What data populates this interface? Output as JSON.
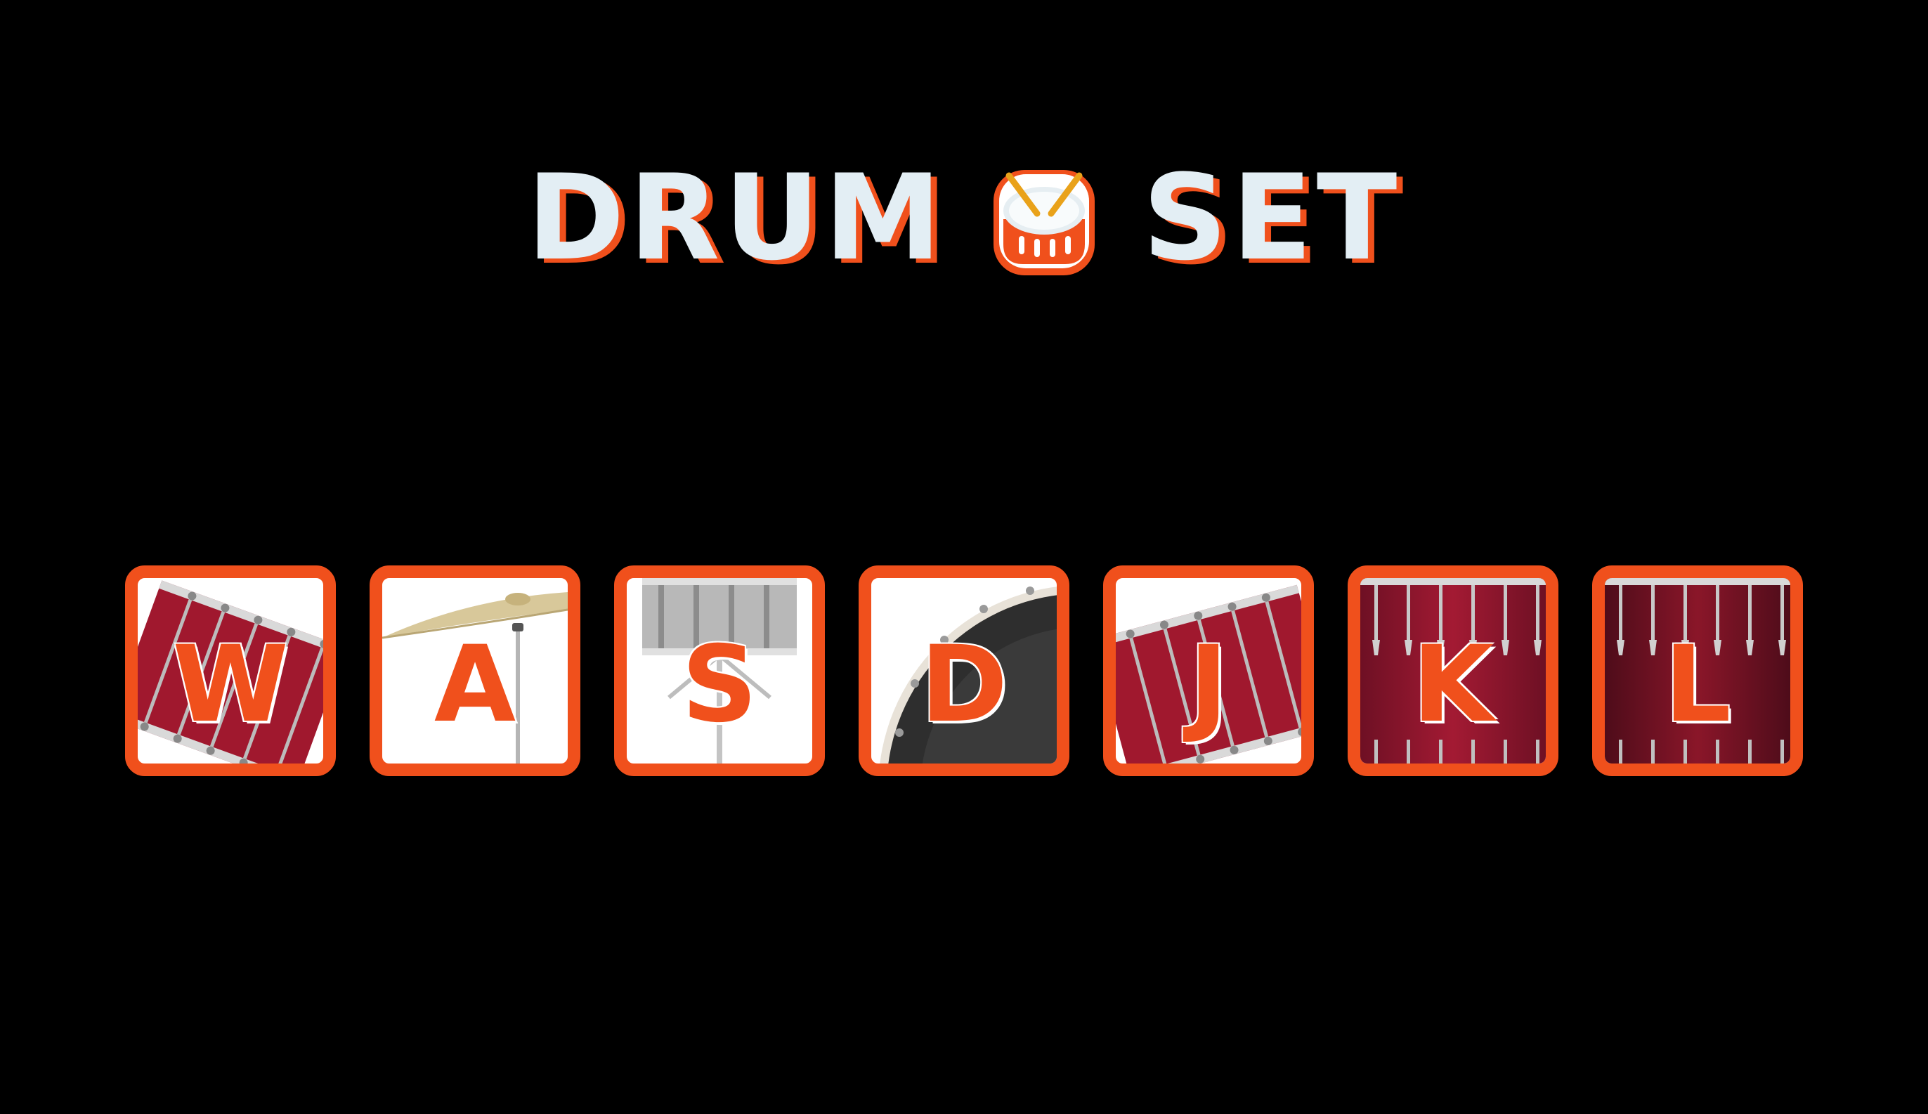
{
  "title": {
    "left_word": "DRUM",
    "right_word": "SET",
    "icon": "drum-emoji-icon"
  },
  "colors": {
    "background": "#000000",
    "accent": "#f0501c",
    "title_text": "#e3eef4",
    "pad_fill": "#ffffff",
    "drum_red": "#a0182e",
    "cymbal": "#d8c89a",
    "snare_silver": "#b8b8b8",
    "kick_black": "#2e2e2e"
  },
  "pads": [
    {
      "key": "W",
      "instrument_icon": "tom-drum-icon"
    },
    {
      "key": "A",
      "instrument_icon": "cymbal-icon"
    },
    {
      "key": "S",
      "instrument_icon": "snare-drum-icon"
    },
    {
      "key": "D",
      "instrument_icon": "kick-drum-icon"
    },
    {
      "key": "J",
      "instrument_icon": "tom-drum-icon"
    },
    {
      "key": "K",
      "instrument_icon": "floor-tom-icon"
    },
    {
      "key": "L",
      "instrument_icon": "floor-tom-icon"
    }
  ]
}
